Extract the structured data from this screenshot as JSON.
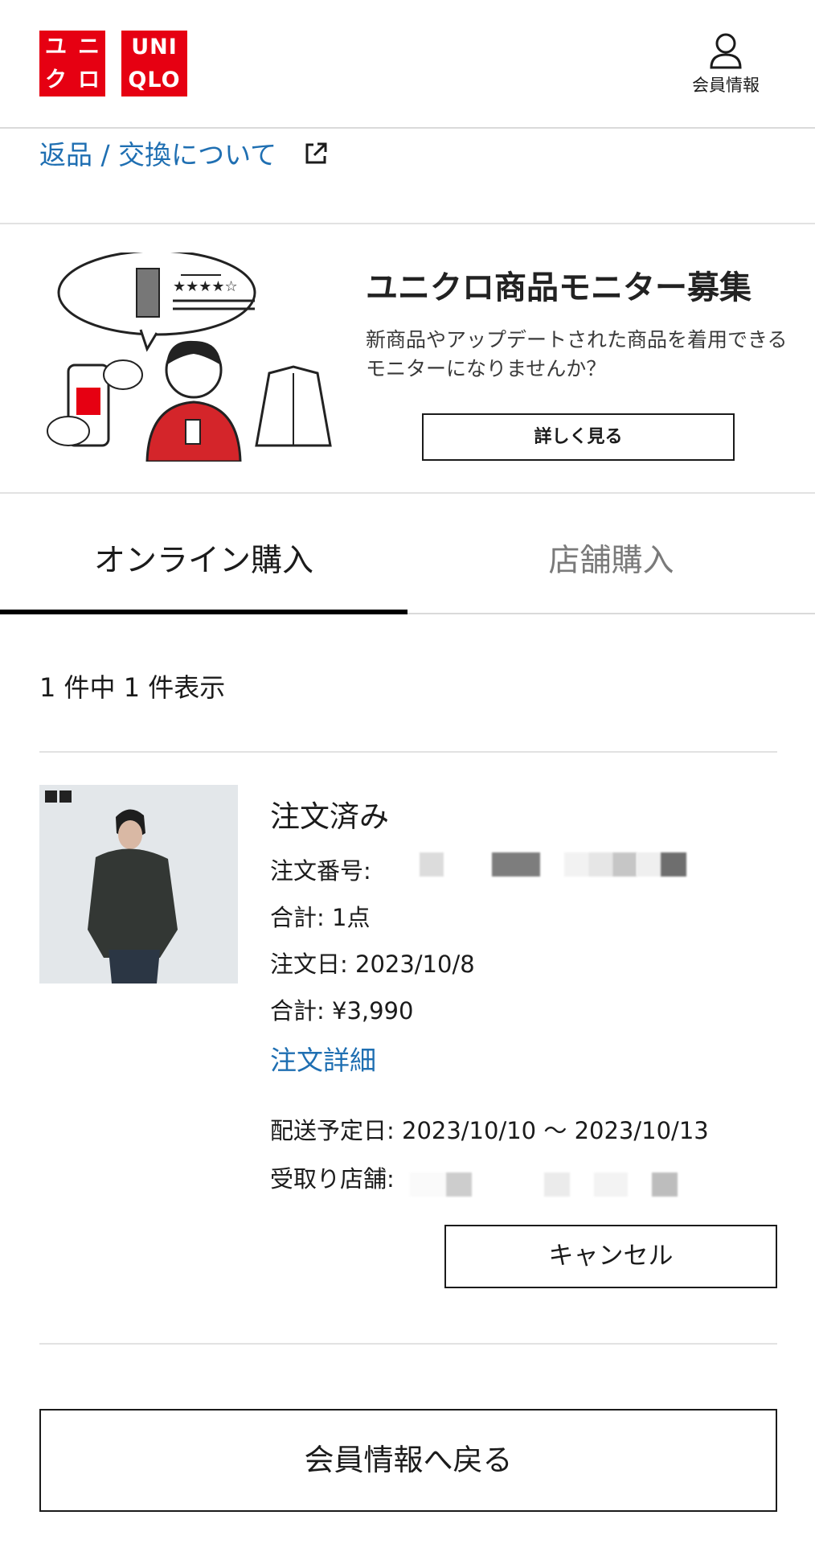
{
  "header": {
    "logo_katakana": [
      "ユ",
      "ニ",
      "ク",
      "ロ"
    ],
    "logo_latin": [
      "UNI",
      "QLO"
    ],
    "member_label": "会員情報"
  },
  "return_link": {
    "label": "返品 / 交換について"
  },
  "banner": {
    "title": "ユニクロ商品モニター募集",
    "description_line1": "新商品やアップデートされた商品を着用できる",
    "description_line2": "モニターになりませんか？",
    "button_label": "詳しく見る"
  },
  "tabs": [
    {
      "label": "オンライン購入",
      "active": true
    },
    {
      "label": "店舗購入",
      "active": false
    }
  ],
  "result_count": "1 件中 1 件表示",
  "order": {
    "status": "注文済み",
    "number_label": "注文番号:",
    "quantity_line": "合計: 1点",
    "date_line": "注文日: 2023/10/8",
    "total_line": "合計: ¥3,990",
    "detail_link": "注文詳細",
    "delivery_line": "配送予定日: 2023/10/10 〜 2023/10/13",
    "store_label": "受取り店舗:",
    "cancel_label": "キャンセル"
  },
  "back_button": "会員情報へ戻る",
  "colors": {
    "brand_red": "#e60012",
    "link_blue": "#1f6fb2"
  }
}
